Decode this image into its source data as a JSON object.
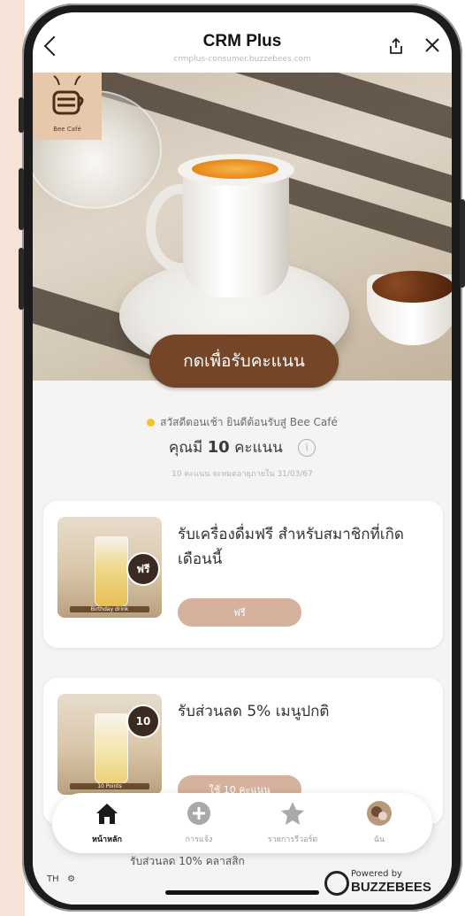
{
  "header": {
    "title": "CRM Plus",
    "subtitle": "crmplus-consumer.buzzebees.com"
  },
  "hero": {
    "logo_text": "Bee Café",
    "scan_button": "กดเพื่อรับคะแนน"
  },
  "greeting": {
    "text": "สวัสดีตอนเช้า ยินดีต้อนรับสู่ Bee Café",
    "points_prefix": "คุณมี",
    "points_value": "10",
    "points_suffix": "คะแนน",
    "expire_note": "10 คะแนน จะหมดอายุภายใน 31/03/67"
  },
  "rewards": [
    {
      "title": "รับเครื่องดื่มฟรี สำหรับสมาชิกที่เกิดเดือนนี้",
      "badge": "ฟรี",
      "thumb_label": "Birthday drink",
      "button": "ฟรี"
    },
    {
      "title": "รับส่วนลด 5% เมนูปกติ",
      "badge": "10",
      "thumb_label": "10 Points",
      "button": "ใช้ 10 คะแนน"
    }
  ],
  "partial_text": "รับส่วนลด 10% คลาสสิก",
  "nav": [
    {
      "label": "หน้าหลัก",
      "icon": "home-icon"
    },
    {
      "label": "การแจ้ง",
      "icon": "plus-circle-icon"
    },
    {
      "label": "รายการรีวอร์ด",
      "icon": "star-icon"
    },
    {
      "label": "ฉัน",
      "icon": "profile-avatar-icon"
    }
  ],
  "footer": {
    "lang": "TH",
    "powered_by": "Powered by",
    "brand": "BUZZEBEES"
  },
  "colors": {
    "accent": "#744526",
    "pill": "#d6b29e",
    "page_bg": "#f6e3d8"
  }
}
